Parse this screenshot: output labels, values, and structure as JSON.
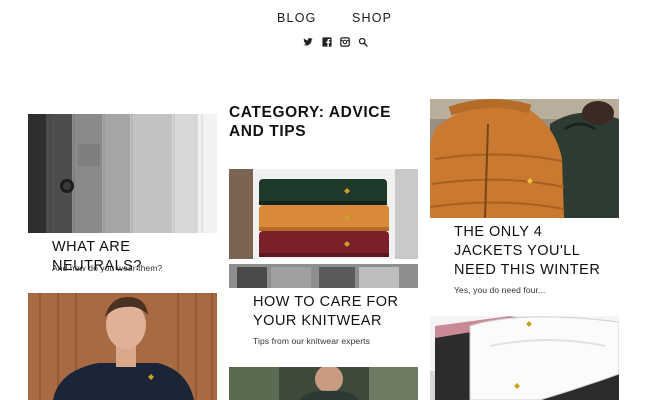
{
  "nav": {
    "blog": "BLOG",
    "shop": "SHOP"
  },
  "social": [
    "twitter-icon",
    "facebook-icon",
    "instagram-icon",
    "search-icon"
  ],
  "category": {
    "title": "CATEGORY: ADVICE AND TIPS"
  },
  "posts": [
    {
      "title": "WHAT ARE NEUTRALS?",
      "subtitle": "And how do you wear them?"
    },
    {
      "title": "HOW TO CARE FOR YOUR KNITWEAR",
      "subtitle": "Tips from our knitwear experts"
    },
    {
      "title": "THE ONLY 4 JACKETS YOU'LL NEED THIS WINTER",
      "subtitle": "Yes, you do need four..."
    }
  ],
  "colors": {
    "text": "#111111",
    "accent_eagle": "#c9a227"
  }
}
